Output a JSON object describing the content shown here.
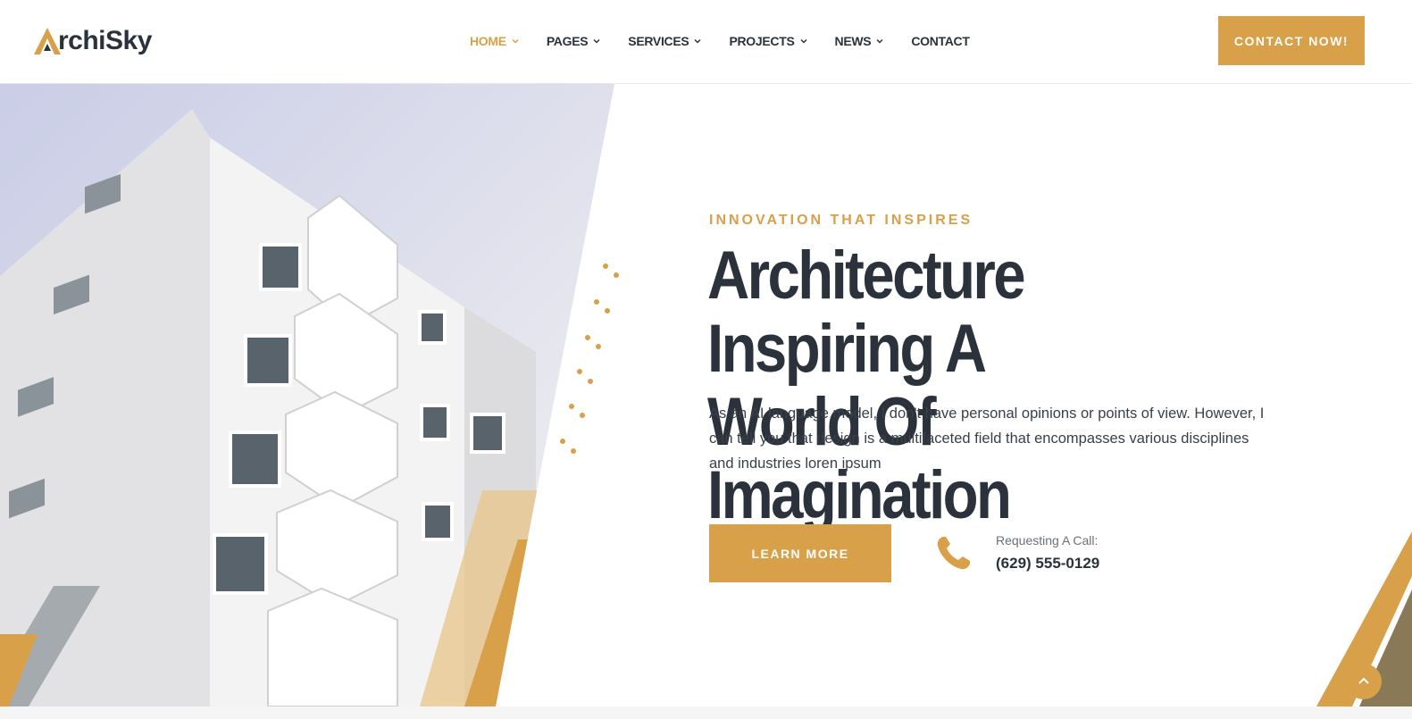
{
  "brand": {
    "logo_text": "rchiSky",
    "accent_color": "#d9a04a",
    "dark_color": "#2b323b"
  },
  "nav": {
    "items": [
      {
        "label": "HOME",
        "has_dropdown": true,
        "active": true
      },
      {
        "label": "PAGES",
        "has_dropdown": true,
        "active": false
      },
      {
        "label": "SERVICES",
        "has_dropdown": true,
        "active": false
      },
      {
        "label": "PROJECTS",
        "has_dropdown": true,
        "active": false
      },
      {
        "label": "NEWS",
        "has_dropdown": true,
        "active": false
      },
      {
        "label": "CONTACT",
        "has_dropdown": false,
        "active": false
      }
    ],
    "cta_label": "CONTACT NOW!"
  },
  "hero": {
    "eyebrow": "INNOVATION THAT INSPIRES",
    "headline_line1": "Architecture Inspiring A",
    "headline_line2": "World Of Imagination",
    "description": "As an AI language model, I don't have personal opinions or points of view. However, I can tell you that design is a multifaceted field that encompasses various disciplines and industries loren ipsum",
    "button_label": "LEARN MORE",
    "call_label": "Requesting A Call:",
    "call_number": "(629) 555-0129"
  },
  "icons": {
    "phone": "phone-icon",
    "chevron": "chevron-down-icon",
    "scroll_top": "chevron-up-icon"
  }
}
